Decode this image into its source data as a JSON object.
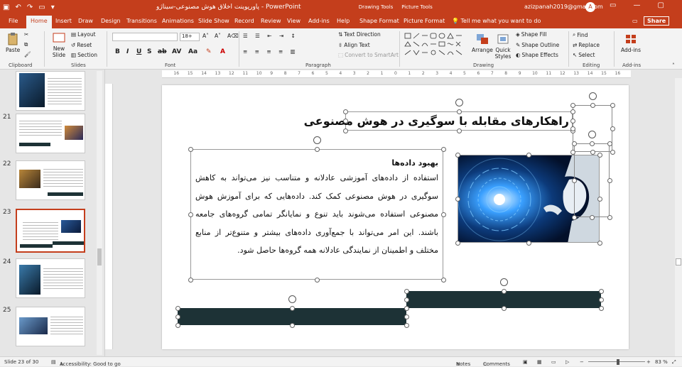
{
  "titlebar": {
    "doc_title": "پاورپوینت اخلاق هوش مصنوعی-سیناژو  -  PowerPoint",
    "ctx_drawing": "Drawing Tools",
    "ctx_picture": "Picture Tools",
    "account": "azizpanah2019@gmail.com",
    "avatar": "A"
  },
  "tabs": [
    "File",
    "Home",
    "Insert",
    "Draw",
    "Design",
    "Transitions",
    "Animations",
    "Slide Show",
    "Record",
    "Review",
    "View",
    "Add-ins",
    "Help",
    "Shape Format",
    "Picture Format"
  ],
  "tell_me": "Tell me what you want to do",
  "share": "Share",
  "ribbon": {
    "paste": "Paste",
    "new_slide": "New Slide",
    "layout": "Layout",
    "reset": "Reset",
    "section": "Section",
    "font_size": "18+",
    "text_direction": "Text Direction",
    "align_text": "Align Text",
    "convert_smartart": "Convert to SmartArt",
    "arrange": "Arrange",
    "quick_styles": "Quick Styles",
    "shape_fill": "Shape Fill",
    "shape_outline": "Shape Outline",
    "shape_effects": "Shape Effects",
    "find": "Find",
    "replace": "Replace",
    "select": "Select",
    "addins": "Add-ins",
    "groups": {
      "clipboard": "Clipboard",
      "slides": "Slides",
      "font": "Font",
      "paragraph": "Paragraph",
      "drawing": "Drawing",
      "editing": "Editing",
      "addins": "Add-ins"
    }
  },
  "ruler_numbers": [
    "16",
    "15",
    "14",
    "13",
    "12",
    "11",
    "10",
    "9",
    "8",
    "7",
    "6",
    "5",
    "4",
    "3",
    "2",
    "1",
    "0",
    "1",
    "2",
    "3",
    "4",
    "5",
    "6",
    "7",
    "8",
    "9",
    "10",
    "11",
    "12",
    "13",
    "14",
    "15",
    "16"
  ],
  "thumbnails": [
    {
      "num": "21"
    },
    {
      "num": "22"
    },
    {
      "num": "23",
      "selected": true
    },
    {
      "num": "24"
    },
    {
      "num": "25"
    }
  ],
  "slide": {
    "title": "راهکارهای مقابله با سوگیری در هوش مصنوعی",
    "heading": "بهبود داده‌ها",
    "body": "استفاده از داده‌های آموزشی عادلانه و متناسب نیز می‌تواند به کاهش سوگیری در هوش مصنوعی کمک کند. داده‌هایی که برای آموزش هوش مصنوعی استفاده می‌شوند باید تنوع و نمایانگر تمامی گروه‌های جامعه باشند. این امر می‌تواند با جمع‌آوری داده‌های بیشتر و متنوع‌تر از منابع مختلف و اطمینان از نمایندگی عادلانه همه گروه‌ها حاصل شود."
  },
  "status": {
    "slide_count": "Slide 23 of 30",
    "accessibility": "Accessibility: Good to go",
    "notes": "Notes",
    "comments": "Comments",
    "zoom": "83 %"
  },
  "colors": {
    "accent": "#c43e1c",
    "shape_fill": "#1d3236"
  }
}
